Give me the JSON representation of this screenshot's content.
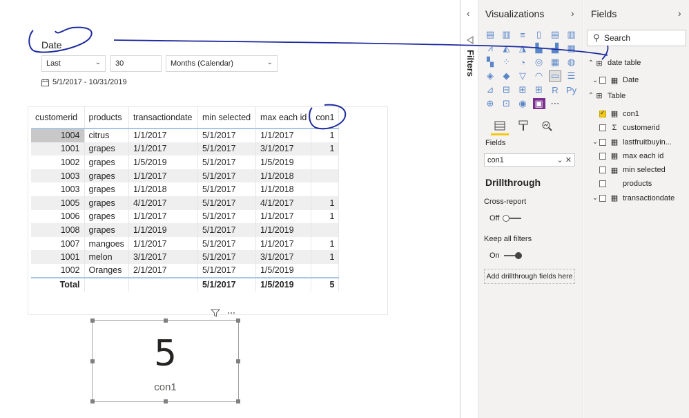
{
  "slicer": {
    "title": "Date",
    "period_mode": "Last",
    "period_count": "30",
    "period_unit": "Months (Calendar)",
    "range_text": "5/1/2017 - 10/31/2019"
  },
  "table": {
    "headers": [
      "customerid",
      "products",
      "transactiondate",
      "min selected",
      "max each id",
      "con1"
    ],
    "rows": [
      [
        "1004",
        "citrus",
        "1/1/2017",
        "5/1/2017",
        "1/1/2017",
        "1"
      ],
      [
        "1001",
        "grapes",
        "1/1/2017",
        "5/1/2017",
        "3/1/2017",
        "1"
      ],
      [
        "1002",
        "grapes",
        "1/5/2019",
        "5/1/2017",
        "1/5/2019",
        ""
      ],
      [
        "1003",
        "grapes",
        "1/1/2017",
        "5/1/2017",
        "1/1/2018",
        ""
      ],
      [
        "1003",
        "grapes",
        "1/1/2018",
        "5/1/2017",
        "1/1/2018",
        ""
      ],
      [
        "1005",
        "grapes",
        "4/1/2017",
        "5/1/2017",
        "4/1/2017",
        "1"
      ],
      [
        "1006",
        "grapes",
        "1/1/2017",
        "5/1/2017",
        "1/1/2017",
        "1"
      ],
      [
        "1008",
        "grapes",
        "1/1/2019",
        "5/1/2017",
        "1/1/2019",
        ""
      ],
      [
        "1007",
        "mangoes",
        "1/1/2017",
        "5/1/2017",
        "1/1/2017",
        "1"
      ],
      [
        "1001",
        "melon",
        "3/1/2017",
        "5/1/2017",
        "3/1/2017",
        "1"
      ],
      [
        "1002",
        "Oranges",
        "2/1/2017",
        "5/1/2017",
        "1/5/2019",
        ""
      ]
    ],
    "total": [
      "Total",
      "",
      "",
      "5/1/2017",
      "1/5/2019",
      "5"
    ]
  },
  "card": {
    "value": "5",
    "label": "con1"
  },
  "filters": {
    "label": "Filters"
  },
  "visualizations": {
    "title": "Visualizations",
    "fields_label": "Fields",
    "well_value": "con1",
    "drillthrough_title": "Drillthrough",
    "cross_report_label": "Cross-report",
    "cross_report_state": "Off",
    "keep_filters_label": "Keep all filters",
    "keep_filters_state": "On",
    "add_drillthrough": "Add drillthrough fields here"
  },
  "fields": {
    "title": "Fields",
    "search_placeholder": "Search",
    "tables": [
      {
        "name": "date table",
        "expanded": true,
        "items": [
          {
            "name": "Date",
            "type": "date-hierarchy",
            "checked": false,
            "expandable": true
          }
        ]
      },
      {
        "name": "Table",
        "expanded": true,
        "items": [
          {
            "name": "con1",
            "type": "measure",
            "checked": true
          },
          {
            "name": "customerid",
            "type": "sum",
            "checked": false
          },
          {
            "name": "lastfruitbuyin...",
            "type": "date-hierarchy",
            "checked": false,
            "expandable": true
          },
          {
            "name": "max each id",
            "type": "measure",
            "checked": false
          },
          {
            "name": "min selected",
            "type": "measure",
            "checked": false
          },
          {
            "name": "products",
            "type": "text",
            "checked": false
          },
          {
            "name": "transactiondate",
            "type": "date-hierarchy",
            "checked": false,
            "expandable": true
          }
        ]
      }
    ]
  },
  "colors": {
    "accent": "#f2c811",
    "annotation": "#1d2a9e",
    "header_border": "#a8c5e6"
  }
}
